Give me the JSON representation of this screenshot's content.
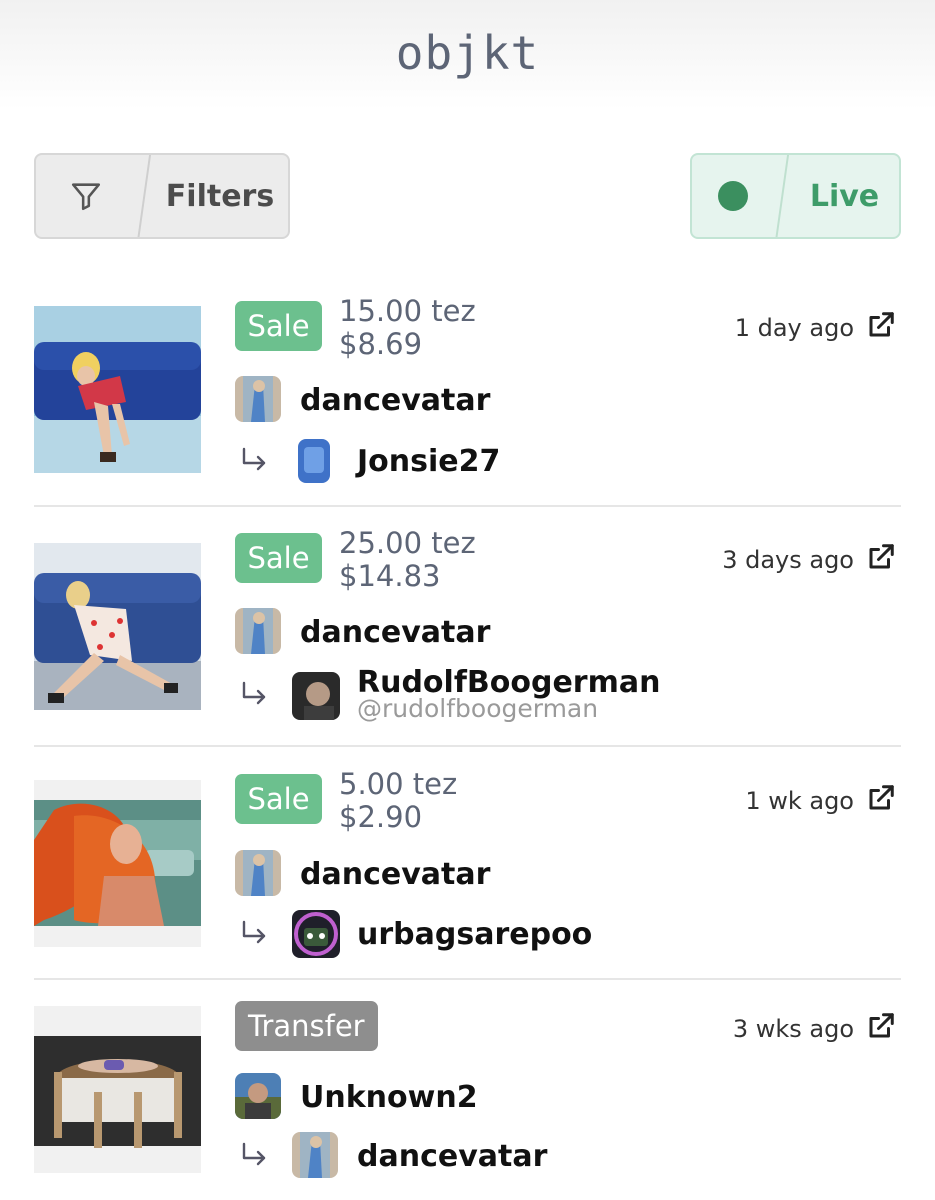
{
  "header": {
    "logo": "objkt"
  },
  "toolbar": {
    "filters_label": "Filters",
    "live_label": "Live",
    "live_color": "#3b8f5f"
  },
  "events": [
    {
      "type": "Sale",
      "price_tez": "15.00 tez",
      "price_usd": "$8.69",
      "time": "1 day ago",
      "from": {
        "name": "dancevatar"
      },
      "to": {
        "name": "Jonsie27"
      }
    },
    {
      "type": "Sale",
      "price_tez": "25.00 tez",
      "price_usd": "$14.83",
      "time": "3 days ago",
      "from": {
        "name": "dancevatar"
      },
      "to": {
        "name": "RudolfBoogerman",
        "handle": "@rudolfboogerman"
      }
    },
    {
      "type": "Sale",
      "price_tez": "5.00 tez",
      "price_usd": "$2.90",
      "time": "1 wk ago",
      "from": {
        "name": "dancevatar"
      },
      "to": {
        "name": "urbagsarepoo"
      }
    },
    {
      "type": "Transfer",
      "time": "3 wks ago",
      "from": {
        "name": "Unknown2"
      },
      "to": {
        "name": "dancevatar"
      }
    }
  ],
  "colors": {
    "sale_badge": "#6cc08e",
    "transfer_badge": "#8e8e8e",
    "price_text": "#5d6576"
  },
  "icons": [
    "filter-icon",
    "live-dot-icon",
    "external-link-icon",
    "reply-arrow-icon"
  ]
}
